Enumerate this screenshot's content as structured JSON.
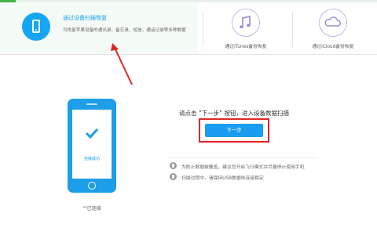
{
  "modes": {
    "device": {
      "title": "通过设备扫描恢复",
      "description": "可恢复苹果设备的通讯录、备忘录、短信、通话记录等多种数据",
      "icon": "phone-icon"
    },
    "itunes": {
      "label": "通过iTunes备份恢复",
      "icon": "music-note-icon"
    },
    "icloud": {
      "label": "通过iCloud备份恢复",
      "icon": "cloud-icon"
    }
  },
  "device": {
    "status": "连接成功",
    "name": "\"\"已连接",
    "check_icon": "checkmark-icon"
  },
  "scan": {
    "prompt": "请点击 “下一步” 按钮，进入设备数据扫描",
    "next_label": "下一步"
  },
  "tips": [
    {
      "text": "为防止数据被覆盖，建议您开启飞行模式并尽量停止使用手机",
      "icon": "info-icon"
    },
    {
      "text": "扫描过程中，请保持USB数据线连接稳定",
      "icon": "info-icon"
    }
  ],
  "colors": {
    "accent_blue": "#1a9df0",
    "highlight_red": "#e0262a",
    "icon_ring": "#c4b7e6",
    "brand_green": "#45b149"
  }
}
